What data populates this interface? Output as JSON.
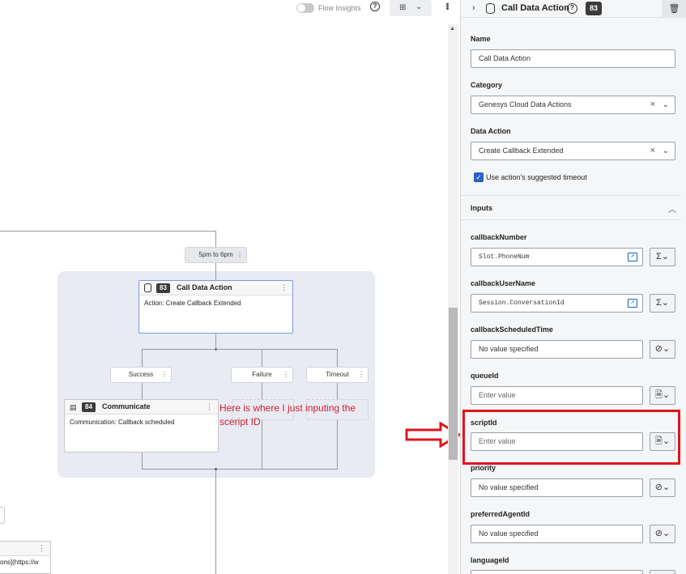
{
  "topbar": {
    "flow_insights_label": "Flow Insights",
    "help_icon": "?",
    "more_icon": "⋮"
  },
  "canvas": {
    "time_pill": "5pm to 6pm",
    "call_node": {
      "badge": "83",
      "title": "Call Data Action",
      "body": "Action: Create Callback Extended"
    },
    "outcomes": {
      "success": "Success",
      "failure": "Failure",
      "timeout": "Timeout"
    },
    "communicate_node": {
      "badge": "84",
      "title": "Communicate",
      "body": "Communication: Callback scheduled"
    },
    "left_partial_text": "ons](https://w",
    "annotation": "Here is where I just inputing the sceript ID"
  },
  "panel": {
    "title": "Call Data Action",
    "badge": "83",
    "name_label": "Name",
    "name_value": "Call Data Action",
    "category_label": "Category",
    "category_value": "Genesys Cloud Data Actions",
    "data_action_label": "Data Action",
    "data_action_value": "Create Callback Extended",
    "timeout_checkbox_label": "Use action's suggested timeout",
    "inputs_label": "Inputs",
    "inputs": [
      {
        "label": "callbackNumber",
        "value": "Slot.PhoneNum",
        "kind": "expr"
      },
      {
        "label": "callbackUserName",
        "value": "Session.ConversationId",
        "kind": "expr"
      },
      {
        "label": "callbackScheduledTime",
        "value": "No value specified",
        "kind": "none"
      },
      {
        "label": "queueId",
        "value": "Enter value",
        "kind": "doc"
      },
      {
        "label": "scriptId",
        "value": "Enter value",
        "kind": "doc"
      },
      {
        "label": "priority",
        "value": "No value specified",
        "kind": "none"
      },
      {
        "label": "preferredAgentId",
        "value": "No value specified",
        "kind": "none"
      },
      {
        "label": "languageId",
        "value": "",
        "kind": "none"
      }
    ]
  },
  "colors": {
    "annotation_red": "#e0141e",
    "accent_blue": "#2a60c6"
  }
}
